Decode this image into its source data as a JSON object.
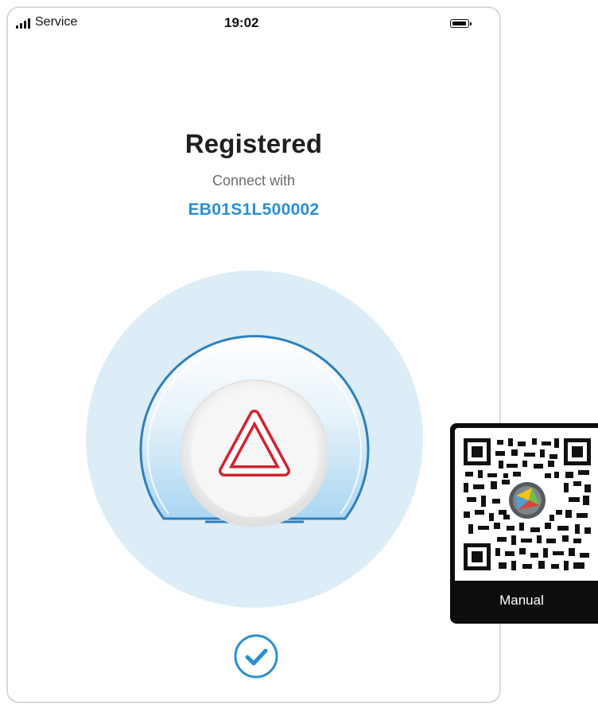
{
  "status_bar": {
    "carrier": "Service",
    "time": "19:02"
  },
  "main": {
    "title": "Registered",
    "subtitle": "Connect with",
    "device_id": "EB01S1L500002"
  },
  "colors": {
    "accent_blue": "#2a8fd0",
    "brand_red": "#d42230",
    "halo_blue": "#dcedf7"
  },
  "icons": {
    "hub": "triangle-logo-icon",
    "confirm": "checkmark-icon"
  },
  "qr_card": {
    "label": "Manual"
  }
}
